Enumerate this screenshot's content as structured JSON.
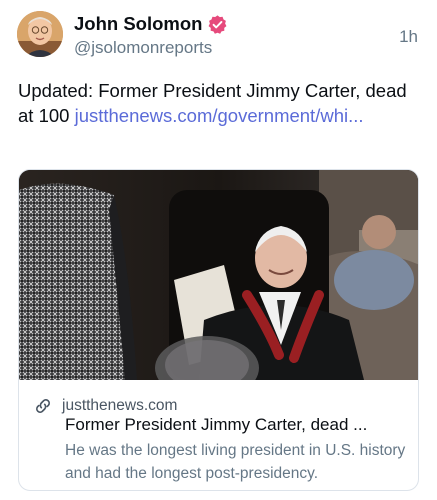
{
  "author": {
    "name": "John Solomon",
    "handle": "@jsolomonreports",
    "verified": true,
    "verified_color": "#e64a7c"
  },
  "post": {
    "time": "1h",
    "text": "Updated: Former President Jimmy Carter, dead at 100 ",
    "link_text": "justthenews.com/government/whi...",
    "link_color": "#5b6bd8"
  },
  "link_card": {
    "domain": "justthenews.com",
    "title": "Former President Jimmy Carter, dead ...",
    "description": "He was the longest living president in U.S. history and had the longest post-presidency."
  },
  "icons": {
    "verified": "verified-badge-icon",
    "link": "link-chain-icon"
  }
}
